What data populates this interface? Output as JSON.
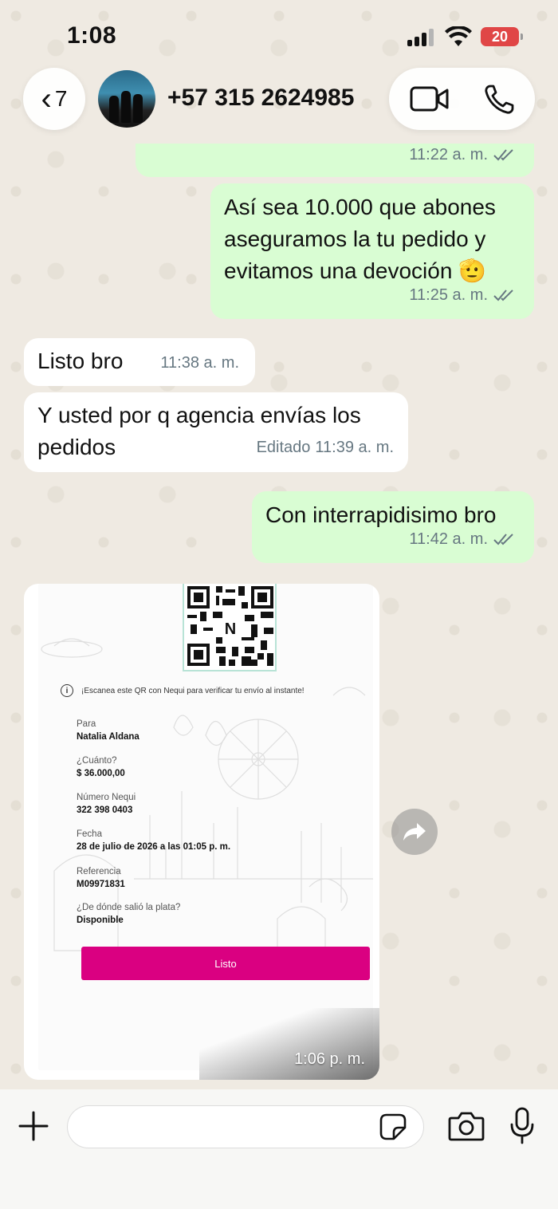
{
  "status_bar": {
    "time": "1:08",
    "battery_level": "20",
    "battery_color": "#e04646"
  },
  "header": {
    "back_count": "7",
    "contact_name": "+57 315 2624985",
    "icons": [
      "chevron-left-icon",
      "video-call-icon",
      "phone-icon"
    ]
  },
  "messages": [
    {
      "direction": "out",
      "text": "",
      "time": "11:22 a. m.",
      "status": "read"
    },
    {
      "direction": "out",
      "text": "Así sea 10.000 que abones aseguramos la tu pedido y evitamos una devoción 🫡",
      "line1": "Así sea 10.000 que abones",
      "line2": "aseguramos la tu pedido y",
      "line3": "evitamos una devoción 🫡",
      "time": "11:25 a. m.",
      "status": "read"
    },
    {
      "direction": "in",
      "text": "Listo bro",
      "time": "11:38 a. m."
    },
    {
      "direction": "in",
      "line1": "Y usted por q agencia envías los",
      "line2": "pedidos",
      "edited_label": "Editado",
      "time": "11:39 a. m."
    },
    {
      "direction": "out",
      "text": "Con interrapidisimo bro",
      "time": "11:42 a. m.",
      "status": "read"
    }
  ],
  "image_message": {
    "time": "1:06 p. m.",
    "receipt": {
      "qr_caption": "¡Escanea este QR con Nequi para verificar tu envío al instante!",
      "fields": [
        {
          "label": "Para",
          "value": "Natalia Aldana"
        },
        {
          "label": "¿Cuánto?",
          "value": "$ 36.000,00"
        },
        {
          "label": "Número Nequi",
          "value": "322 398 0403"
        },
        {
          "label": "Fecha",
          "value": "28 de julio de 2026 a las 01:05 p. m."
        },
        {
          "label": "Referencia",
          "value": "M09971831"
        },
        {
          "label": "¿De dónde salió la plata?",
          "value": "Disponible"
        }
      ],
      "button_label": "Listo",
      "button_color": "#da0081"
    }
  },
  "composer": {
    "placeholder": "",
    "icons": [
      "plus-icon",
      "sticker-icon",
      "camera-icon",
      "microphone-icon"
    ]
  },
  "colors": {
    "outgoing_bubble": "#d9fdd3",
    "incoming_bubble": "#ffffff",
    "wallpaper": "#efeae2",
    "meta_text": "#667781"
  }
}
